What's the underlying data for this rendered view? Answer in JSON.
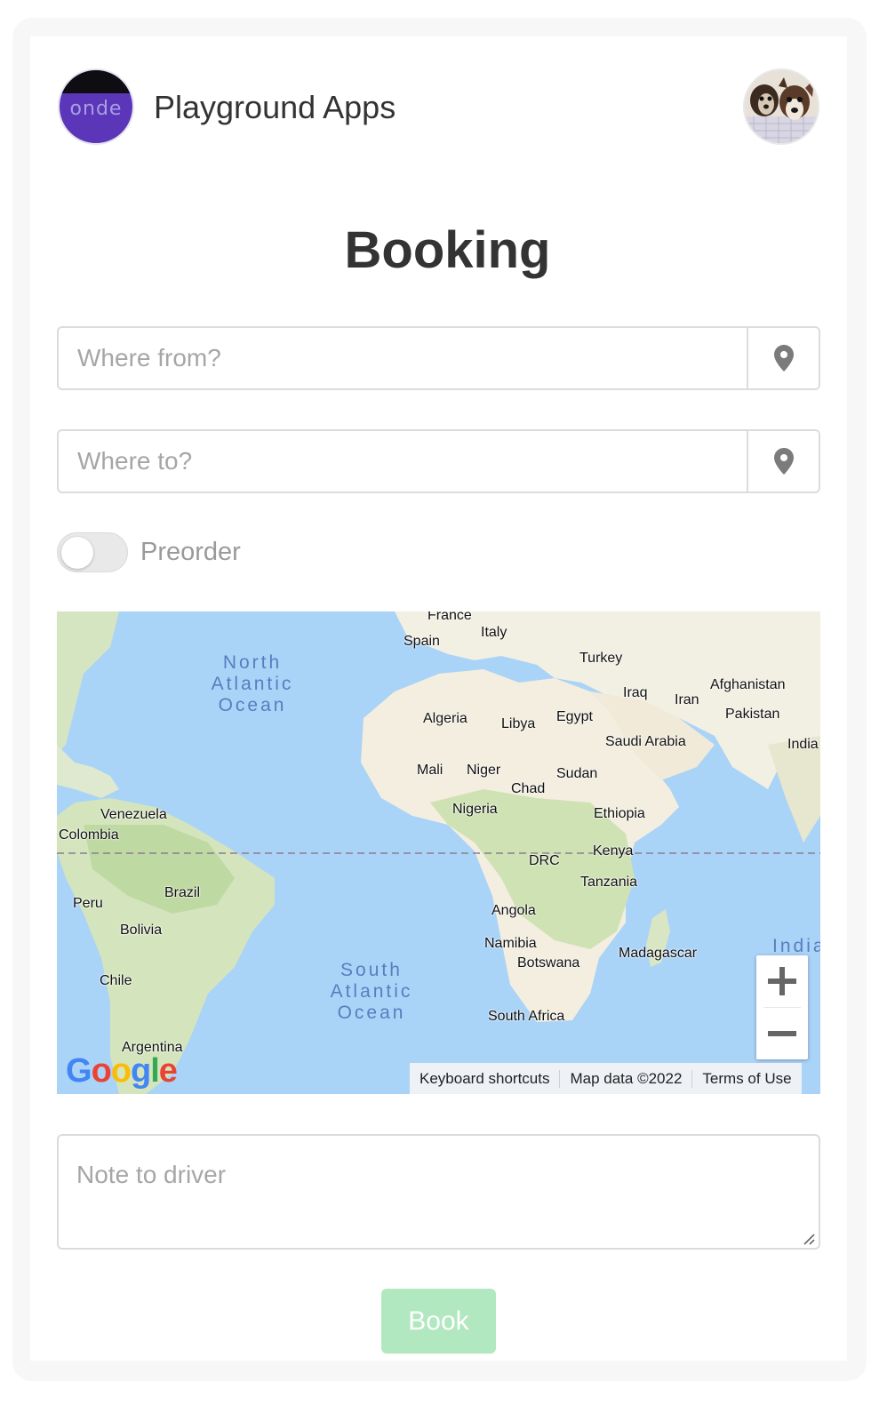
{
  "header": {
    "logo_text": "onde",
    "app_title": "Playground Apps",
    "avatar_icon": "dog-avatar-icon"
  },
  "page": {
    "title": "Booking"
  },
  "form": {
    "from_placeholder": "Where from?",
    "from_icon": "location-pin-icon",
    "to_placeholder": "Where to?",
    "to_icon": "location-pin-icon",
    "preorder_label": "Preorder",
    "preorder_enabled": false,
    "note_placeholder": "Note to driver",
    "book_label": "Book"
  },
  "map": {
    "countries": [
      "France",
      "Italy",
      "Spain",
      "Turkey",
      "Iraq",
      "Iran",
      "Afghanistan",
      "Pakistan",
      "India",
      "Algeria",
      "Libya",
      "Egypt",
      "Saudi Arabia",
      "Mali",
      "Niger",
      "Chad",
      "Sudan",
      "Nigeria",
      "Ethiopia",
      "Venezuela",
      "Colombia",
      "Kenya",
      "DRC",
      "Tanzania",
      "Brazil",
      "Peru",
      "Angola",
      "Bolivia",
      "Namibia",
      "Botswana",
      "Madagascar",
      "Chile",
      "South Africa",
      "Argentina"
    ],
    "oceans": [
      "North Atlantic Ocean",
      "South Atlantic Ocean",
      "Indian Ocean"
    ],
    "zoom_in_icon": "plus-icon",
    "zoom_out_icon": "minus-icon",
    "provider_logo": "Google",
    "attribution": {
      "keyboard": "Keyboard shortcuts",
      "map_data": "Map data ©2022",
      "terms": "Terms of Use"
    },
    "colors": {
      "water": "#aad3f8",
      "land": "#f4f1e6",
      "vegetation": "#cfe3b8",
      "ocean_label": "#5a7dbf"
    }
  },
  "colors": {
    "book_button": "#b2e8bf",
    "logo": "#5b36b8"
  }
}
